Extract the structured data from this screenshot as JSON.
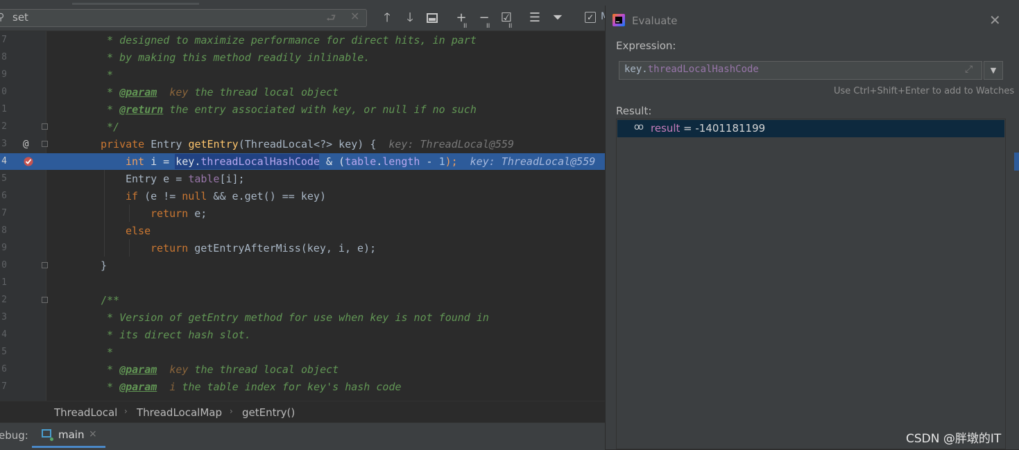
{
  "search": {
    "value": "set",
    "placeholder": ""
  },
  "toolbar": {
    "match_case_checked": true,
    "partial_label": "M"
  },
  "gutter": {
    "line_numbers": [
      "7",
      "8",
      "9",
      "0",
      "1",
      "2",
      "3",
      "4",
      "5",
      "6",
      "7",
      "8",
      "9",
      "0",
      "1",
      "2",
      "3",
      "4",
      "5",
      "6",
      "7"
    ],
    "at_marker": "@"
  },
  "code": {
    "line1": " * designed to maximize performance for direct hits, in part",
    "line2": " * by making this method readily inlinable.",
    "line3": " *",
    "line4_star": " * ",
    "line4_tag": "@param",
    "line4_param": "  key",
    "line4_rest": " the thread local object",
    "line5_star": " * ",
    "line5_tag": "@return",
    "line5_rest": " the entry associated with key, or null if no such",
    "line6": " */",
    "line7_kw": "private",
    "line7_type": " Entry ",
    "line7_fn": "getEntry",
    "line7_args": "(ThreadLocal<?> key) {",
    "line7_hint": "key: ThreadLocal@559",
    "line8_kw": "int",
    "line8_a": " i = ",
    "line8_sel": "key.",
    "line8_fld": "threadLocalHashCode",
    "line8_b": " & (",
    "line8_fld2": "table",
    "line8_dot": ".",
    "line8_fld3": "length",
    "line8_c": " - ",
    "line8_num": "1",
    "line8_d": ");",
    "line8_hint": "key: ThreadLocal@559",
    "line9_a": "Entry e = ",
    "line9_fld": "table",
    "line9_b": "[i];",
    "line10_kw": "if",
    "line10_a": " (e != ",
    "line10_kw2": "null",
    "line10_b": " && e.get() == key)",
    "line11_kw": "return",
    "line11_a": " e;",
    "line12_kw": "else",
    "line13_kw": "return",
    "line13_a": " getEntryAfterMiss(key, i, e);",
    "line14": "}",
    "line16": "/**",
    "line17": " * Version of getEntry method for use when key is not found in",
    "line18": " * its direct hash slot.",
    "line19": " *",
    "line20_star": " * ",
    "line20_tag": "@param",
    "line20_param": "  key",
    "line20_rest": " the thread local object",
    "line21_star": " * ",
    "line21_tag": "@param",
    "line21_param": "  i",
    "line21_rest": " the table index for key's hash code"
  },
  "breadcrumbs": [
    "ThreadLocal",
    "ThreadLocalMap",
    "getEntry()"
  ],
  "debug": {
    "label": "ebug:",
    "tab_label": "main",
    "tab_close": "×"
  },
  "evaluate": {
    "title": "Evaluate",
    "close": "✕",
    "expression_label": "Expression:",
    "expression_prefix": "key.",
    "expression_field": "threadLocalHashCode",
    "watch_hint": "Use Ctrl+Shift+Enter to add to Watches",
    "result_label": "Result:",
    "result_name": "result",
    "result_value": " = -1401181199"
  },
  "watermark": "CSDN @胖墩的IT",
  "colors": {
    "editor_bg": "#2b2b2b",
    "panel_bg": "#3c3f41",
    "execution_line": "#2d5b9a",
    "comment": "#629755",
    "keyword": "#cc7832",
    "field": "#9876aa",
    "function": "#ffc66d"
  }
}
